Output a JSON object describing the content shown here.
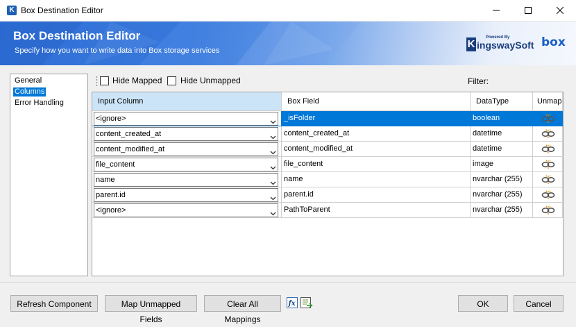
{
  "window": {
    "title": "Box Destination Editor",
    "app_icon_letter": "K"
  },
  "banner": {
    "title": "Box Destination Editor",
    "subtitle": "Specify how you want to write data into Box storage services",
    "logo_powered_by": "Powered By",
    "logo_k": "K",
    "logo_name": "ingswaySoft",
    "box_logo": "box"
  },
  "nav": {
    "items": [
      "General",
      "Columns",
      "Error Handling"
    ],
    "selected": "Columns"
  },
  "toolbar": {
    "hide_mapped": "Hide Mapped",
    "hide_unmapped": "Hide Unmapped",
    "filter_label": "Filter:",
    "filter_value": ""
  },
  "grid": {
    "headers": [
      "Input Column",
      "Box Field",
      "DataType",
      "Unmap"
    ],
    "rows": [
      {
        "input": "<ignore>",
        "field": "_isFolder",
        "type": "boolean"
      },
      {
        "input": "content_created_at",
        "field": "content_created_at",
        "type": "datetime"
      },
      {
        "input": "content_modified_at",
        "field": "content_modified_at",
        "type": "datetime"
      },
      {
        "input": "file_content",
        "field": "file_content",
        "type": "image"
      },
      {
        "input": "name",
        "field": "name",
        "type": "nvarchar (255)"
      },
      {
        "input": "parent.id",
        "field": "parent.id",
        "type": "nvarchar (255)"
      },
      {
        "input": "<ignore>",
        "field": "PathToParent",
        "type": "nvarchar (255)"
      }
    ],
    "selected_row": 0
  },
  "buttons": {
    "refresh": "Refresh Component",
    "map_unmapped": "Map Unmapped Fields",
    "clear_all": "Clear All Mappings",
    "ok": "OK",
    "cancel": "Cancel"
  },
  "icons": {
    "expression": "fx-icon",
    "export": "export-mappings-icon",
    "unmap": "unmap-link-icon"
  },
  "colors": {
    "selection": "#0078d7",
    "header_selected": "#cce4f7",
    "banner": "#2d6fd6"
  }
}
